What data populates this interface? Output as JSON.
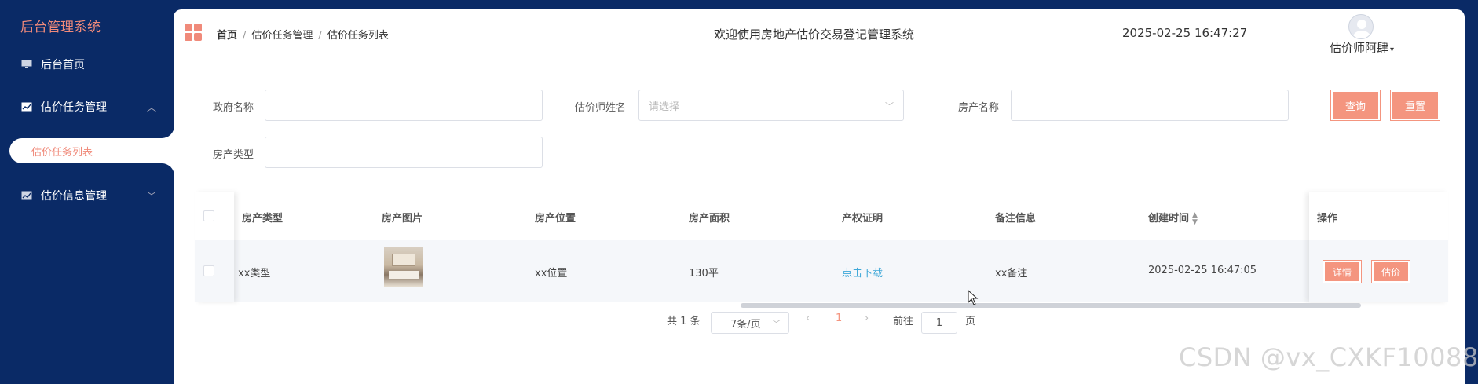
{
  "sidebar": {
    "title": "后台管理系统",
    "items": [
      {
        "label": "后台首页",
        "icon": "monitor-icon"
      },
      {
        "label": "估价任务管理",
        "icon": "chart-icon",
        "expanded": true
      },
      {
        "label": "估价信息管理",
        "icon": "chart-icon",
        "expanded": false
      }
    ],
    "active_sub": "估价任务列表"
  },
  "header": {
    "breadcrumb": [
      "首页",
      "估价任务管理",
      "估价任务列表"
    ],
    "welcome": "欢迎使用房地产估价交易登记管理系统",
    "datetime": "2025-02-25 16:47:27",
    "username": "估价师阿肆"
  },
  "search": {
    "gov_label": "政府名称",
    "gov_value": "",
    "appraiser_label": "估价师姓名",
    "appraiser_placeholder": "请选择",
    "property_label": "房产名称",
    "property_value": "",
    "type_label": "房产类型",
    "type_value": "",
    "query_btn": "查询",
    "reset_btn": "重置"
  },
  "table": {
    "columns": [
      "房产类型",
      "房产图片",
      "房产位置",
      "房产面积",
      "产权证明",
      "备注信息",
      "创建时间",
      "操作"
    ],
    "rows": [
      {
        "type": "xx类型",
        "location": "xx位置",
        "area": "130平",
        "proof": "点击下载",
        "note": "xx备注",
        "created": "2025-02-25 16:47:05",
        "detail_btn": "详情",
        "estimate_btn": "估价"
      }
    ]
  },
  "pagination": {
    "total": "共 1 条",
    "page_size": "7条/页",
    "current": "1",
    "goto_label": "前往",
    "goto_value": "1",
    "page_suffix": "页"
  },
  "watermark": "CSDN @vx_CXKF10088",
  "colors": {
    "sidebar_bg": "#0a2a66",
    "accent": "#f4957f",
    "link": "#3ea8d8"
  }
}
